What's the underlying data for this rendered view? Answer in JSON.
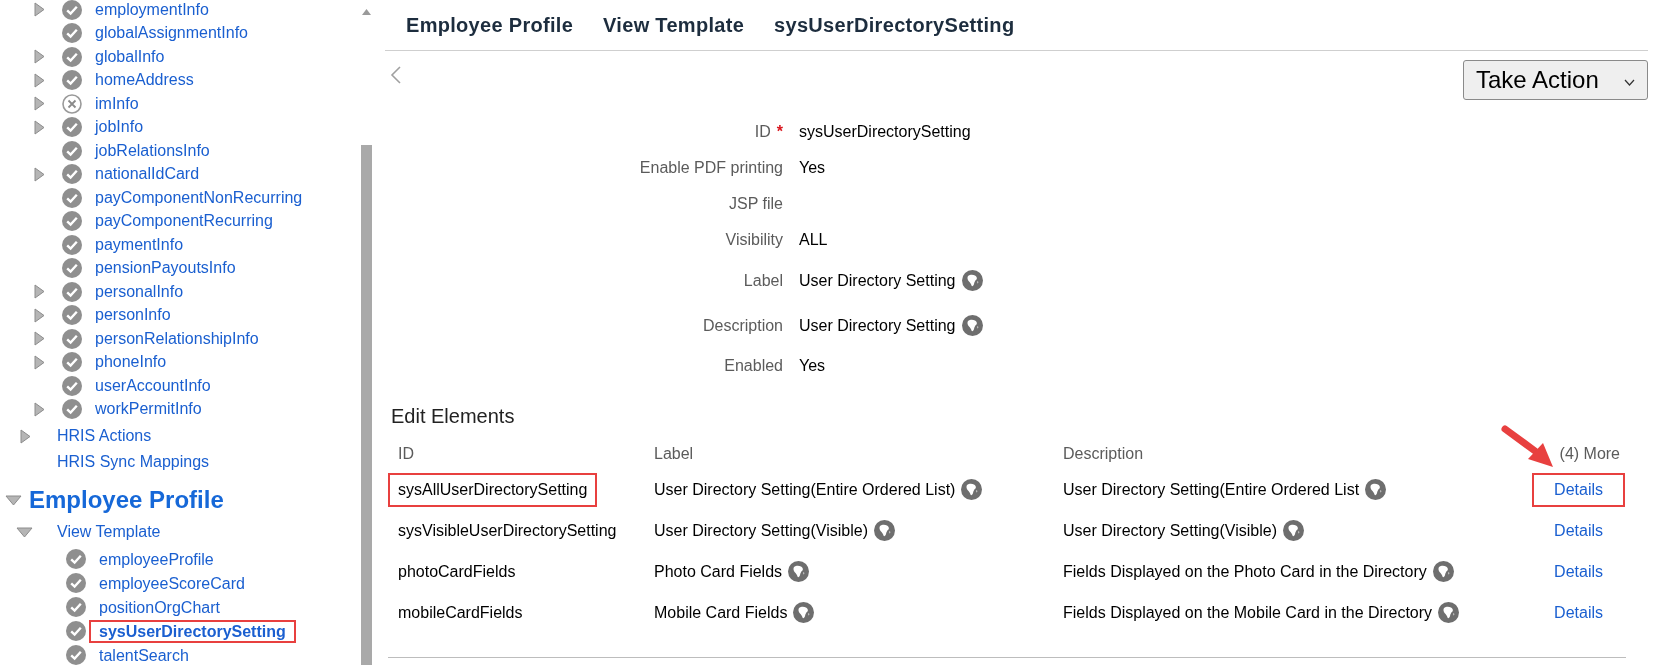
{
  "sidebar": {
    "items": [
      {
        "label": "employmentInfo",
        "expandable": true,
        "included": true
      },
      {
        "label": "globalAssignmentInfo",
        "expandable": false,
        "included": true
      },
      {
        "label": "globalInfo",
        "expandable": true,
        "included": true
      },
      {
        "label": "homeAddress",
        "expandable": true,
        "included": true
      },
      {
        "label": "imInfo",
        "expandable": true,
        "included": false
      },
      {
        "label": "jobInfo",
        "expandable": true,
        "included": true
      },
      {
        "label": "jobRelationsInfo",
        "expandable": false,
        "included": true
      },
      {
        "label": "nationalIdCard",
        "expandable": true,
        "included": true
      },
      {
        "label": "payComponentNonRecurring",
        "expandable": false,
        "included": true
      },
      {
        "label": "payComponentRecurring",
        "expandable": false,
        "included": true
      },
      {
        "label": "paymentInfo",
        "expandable": false,
        "included": true
      },
      {
        "label": "pensionPayoutsInfo",
        "expandable": false,
        "included": true
      },
      {
        "label": "personalInfo",
        "expandable": true,
        "included": true
      },
      {
        "label": "personInfo",
        "expandable": true,
        "included": true
      },
      {
        "label": "personRelationshipInfo",
        "expandable": true,
        "included": true
      },
      {
        "label": "phoneInfo",
        "expandable": true,
        "included": true
      },
      {
        "label": "userAccountInfo",
        "expandable": false,
        "included": true
      },
      {
        "label": "workPermitInfo",
        "expandable": true,
        "included": true
      }
    ],
    "sections": [
      {
        "label": "HRIS Actions",
        "expandable": true
      },
      {
        "label": "HRIS Sync Mappings",
        "expandable": false
      }
    ],
    "module": {
      "label": "Employee Profile",
      "expanded": true,
      "children": [
        {
          "label": "View Template",
          "expanded": true,
          "children": [
            {
              "label": "employeeProfile",
              "included": true,
              "selected": false
            },
            {
              "label": "employeeScoreCard",
              "included": true,
              "selected": false
            },
            {
              "label": "positionOrgChart",
              "included": true,
              "selected": false
            },
            {
              "label": "sysUserDirectorySetting",
              "included": true,
              "selected": true
            },
            {
              "label": "talentSearch",
              "included": true,
              "selected": false
            }
          ]
        }
      ]
    }
  },
  "breadcrumb": [
    "Employee Profile",
    "View Template",
    "sysUserDirectorySetting"
  ],
  "take_action": {
    "label": "Take Action"
  },
  "fields": [
    {
      "label": "ID",
      "required_marker": "*",
      "value": "sysUserDirectorySetting",
      "translatable": false
    },
    {
      "label": "Enable PDF printing",
      "value": "Yes",
      "translatable": false
    },
    {
      "label": "JSP file",
      "translatable": false
    },
    {
      "label": "Visibility",
      "value": "ALL",
      "translatable": false
    },
    {
      "label": "Label",
      "value": "User Directory Setting",
      "translatable": true
    },
    {
      "label": "Description",
      "value": "User Directory Setting",
      "translatable": true
    },
    {
      "label": "Enabled",
      "value": "Yes",
      "translatable": false
    }
  ],
  "edit_elements": {
    "title": "Edit Elements",
    "columns": [
      "ID",
      "Label",
      "Description",
      "(4) More"
    ],
    "pointer_arrow": true,
    "rows": [
      {
        "id": "sysAllUserDirectorySetting",
        "label": "User Directory Setting(Entire Ordered List)",
        "description": "User Directory Setting(Entire Ordered List",
        "link": "Details",
        "id_highlighted": true,
        "link_highlighted": true
      },
      {
        "id": "sysVisibleUserDirectorySetting",
        "label": "User Directory Setting(Visible)",
        "description": "User Directory Setting(Visible)",
        "link": "Details",
        "id_highlighted": false,
        "link_highlighted": false
      },
      {
        "id": "photoCardFields",
        "label": "Photo Card Fields",
        "description": "Fields Displayed on the Photo Card in the Directory",
        "link": "Details",
        "id_highlighted": false,
        "link_highlighted": false
      },
      {
        "id": "mobileCardFields",
        "label": "Mobile Card Fields",
        "description": "Fields Displayed on the Mobile Card in the Directory",
        "link": "Details",
        "id_highlighted": false,
        "link_highlighted": false
      }
    ]
  }
}
